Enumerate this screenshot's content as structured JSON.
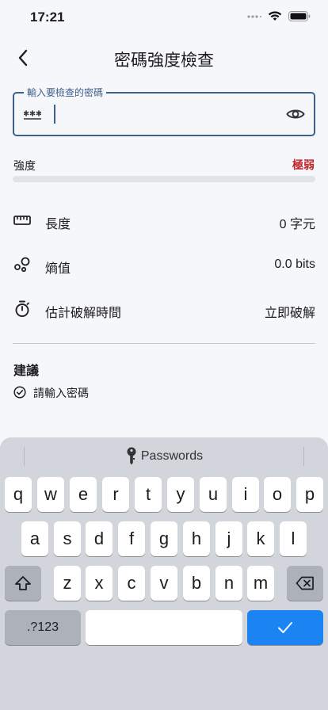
{
  "status": {
    "time": "17:21"
  },
  "nav": {
    "title": "密碼強度檢查",
    "back_icon": "chevron-left-icon"
  },
  "password_field": {
    "label": "輸入要檢查的密碼",
    "value": "",
    "border_color": "#3f5f8a"
  },
  "strength": {
    "label": "強度",
    "value": "極弱",
    "color": "#c0262d",
    "progress": 0
  },
  "metrics": [
    {
      "icon": "ruler-icon",
      "label": "長度",
      "value": "0 字元"
    },
    {
      "icon": "bubbles-icon",
      "label": "熵值",
      "value": "0.0 bits"
    },
    {
      "icon": "timer-icon",
      "label": "估計破解時間",
      "value": "立即破解"
    }
  ],
  "suggestions": {
    "title": "建議",
    "items": [
      {
        "icon": "check-circle-icon",
        "text": "請輸入密碼"
      }
    ]
  },
  "keyboard": {
    "bar_label": "Passwords",
    "row1": [
      "q",
      "w",
      "e",
      "r",
      "t",
      "y",
      "u",
      "i",
      "o",
      "p"
    ],
    "row2": [
      "a",
      "s",
      "d",
      "f",
      "g",
      "h",
      "j",
      "k",
      "l"
    ],
    "row3": [
      "z",
      "x",
      "c",
      "v",
      "b",
      "n",
      "m"
    ],
    "numbers_key": ".?123",
    "accent": "#1a85f2"
  }
}
